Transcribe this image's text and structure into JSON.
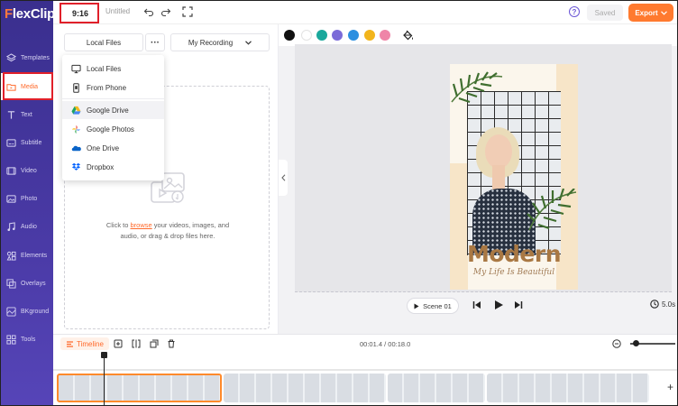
{
  "app": {
    "logo_first": "F",
    "logo_rest": "lexClip",
    "aspect_ratio": "9:16",
    "doc_title": "Untitled",
    "help_label": "?",
    "saved_label": "Saved",
    "export_label": "Export",
    "export_icon": "chevron-down-icon"
  },
  "sidebar": {
    "items": [
      {
        "label": "Templates",
        "icon": "templates-icon"
      },
      {
        "label": "Media",
        "icon": "media-folder-icon",
        "active": true
      },
      {
        "label": "Text",
        "icon": "text-icon"
      },
      {
        "label": "Subtitle",
        "icon": "subtitle-icon"
      },
      {
        "label": "Video",
        "icon": "video-icon"
      },
      {
        "label": "Photo",
        "icon": "photo-icon"
      },
      {
        "label": "Audio",
        "icon": "audio-icon"
      },
      {
        "label": "Elements",
        "icon": "elements-icon"
      },
      {
        "label": "Overlays",
        "icon": "overlays-icon"
      },
      {
        "label": "BKground",
        "icon": "background-icon"
      },
      {
        "label": "Tools",
        "icon": "tools-icon"
      }
    ]
  },
  "media_panel": {
    "local_files_button": "Local Files",
    "more_button": "···",
    "recording_button": "My Recording",
    "dropzone_prefix": "Click to ",
    "dropzone_link": "browse",
    "dropzone_suffix": " your videos, images, and",
    "dropzone_line2": "audio, or drag & drop files here."
  },
  "upload_menu": {
    "items": [
      {
        "label": "Local Files",
        "icon": "monitor-icon"
      },
      {
        "label": "From Phone",
        "icon": "phone-icon"
      },
      {
        "label": "Google Drive",
        "icon": "google-drive-icon",
        "hovered": true
      },
      {
        "label": "Google Photos",
        "icon": "google-photos-icon"
      },
      {
        "label": "One Drive",
        "icon": "onedrive-icon"
      },
      {
        "label": "Dropbox",
        "icon": "dropbox-icon"
      }
    ]
  },
  "color_palette": {
    "swatches": [
      "#111111",
      "#ffffff",
      "#1aa89c",
      "#7b6bd8",
      "#2b8fe0",
      "#f2b51c",
      "#ef85a8"
    ],
    "fill_tool_icon": "paint-bucket-icon"
  },
  "poster": {
    "title": "Modern",
    "subtitle": "My Life Is Beautiful",
    "title_color": "#a97843"
  },
  "playback": {
    "scene_label": "Scene 01",
    "duration": "5.0s"
  },
  "timeline": {
    "label": "Timeline",
    "time_display": "00:01.4 / 00:18.0",
    "add_label": "+"
  },
  "colors": {
    "accent": "#ff6a2b",
    "sidebar": "#3f3399",
    "highlight_box": "#e0202a"
  }
}
